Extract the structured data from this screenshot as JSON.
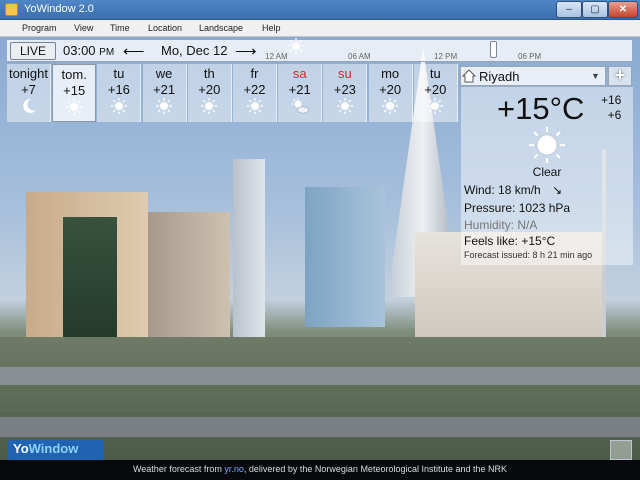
{
  "window": {
    "title": "YoWindow 2.0",
    "min": "–",
    "max": "▢",
    "close": "✕"
  },
  "menu": [
    "Program",
    "View",
    "Time",
    "Location",
    "Landscape",
    "Help"
  ],
  "timebar": {
    "live_label": "LIVE",
    "time": "03:00",
    "ampm": "PM",
    "date": "Mo, Dec 12",
    "ticks": [
      "12 AM",
      "06 AM",
      "12 PM",
      "06 PM"
    ],
    "time_position": 0.625
  },
  "forecast": [
    {
      "day": "tonight",
      "temp": "+7",
      "icon": "moon-icon",
      "weekend": false,
      "selected": false
    },
    {
      "day": "tom.",
      "temp": "+15",
      "icon": "sun-icon",
      "weekend": false,
      "selected": true
    },
    {
      "day": "tu",
      "temp": "+16",
      "icon": "sun-icon",
      "weekend": false,
      "selected": false
    },
    {
      "day": "we",
      "temp": "+21",
      "icon": "sun-icon",
      "weekend": false,
      "selected": false
    },
    {
      "day": "th",
      "temp": "+20",
      "icon": "sun-icon",
      "weekend": false,
      "selected": false
    },
    {
      "day": "fr",
      "temp": "+22",
      "icon": "sun-icon",
      "weekend": false,
      "selected": false
    },
    {
      "day": "sa",
      "temp": "+21",
      "icon": "partly-cloudy-icon",
      "weekend": true,
      "selected": false
    },
    {
      "day": "su",
      "temp": "+23",
      "icon": "sun-icon",
      "weekend": true,
      "selected": false
    },
    {
      "day": "mo",
      "temp": "+20",
      "icon": "sun-icon",
      "weekend": false,
      "selected": false
    },
    {
      "day": "tu",
      "temp": "+20",
      "icon": "sun-icon",
      "weekend": false,
      "selected": false
    }
  ],
  "location": {
    "name": "Riyadh",
    "add_label": "+"
  },
  "current": {
    "temp": "+15°C",
    "high": "+16",
    "low": "+6",
    "condition": "Clear",
    "icon": "sun-icon",
    "wind_label": "Wind:",
    "wind_value": "18 km/h",
    "wind_dir": "↘",
    "pressure_label": "Pressure:",
    "pressure_value": "1023 hPa",
    "humidity_label": "Humidity:",
    "humidity_value": "N/A",
    "feels_label": "Feels like:",
    "feels_value": "+15°C",
    "issued_label": "Forecast issued:",
    "issued_value": "8 h 21 min ago"
  },
  "logo": {
    "yo": "Yo",
    "window": "Window"
  },
  "footer": {
    "prefix": "Weather forecast from",
    "link": "yr.no",
    "suffix": ", delivered by the Norwegian Meteorological Institute and the NRK"
  },
  "colors": {
    "accent": "#1f63b2",
    "weekend": "#cc2b2b",
    "sun": "#ffffff"
  }
}
